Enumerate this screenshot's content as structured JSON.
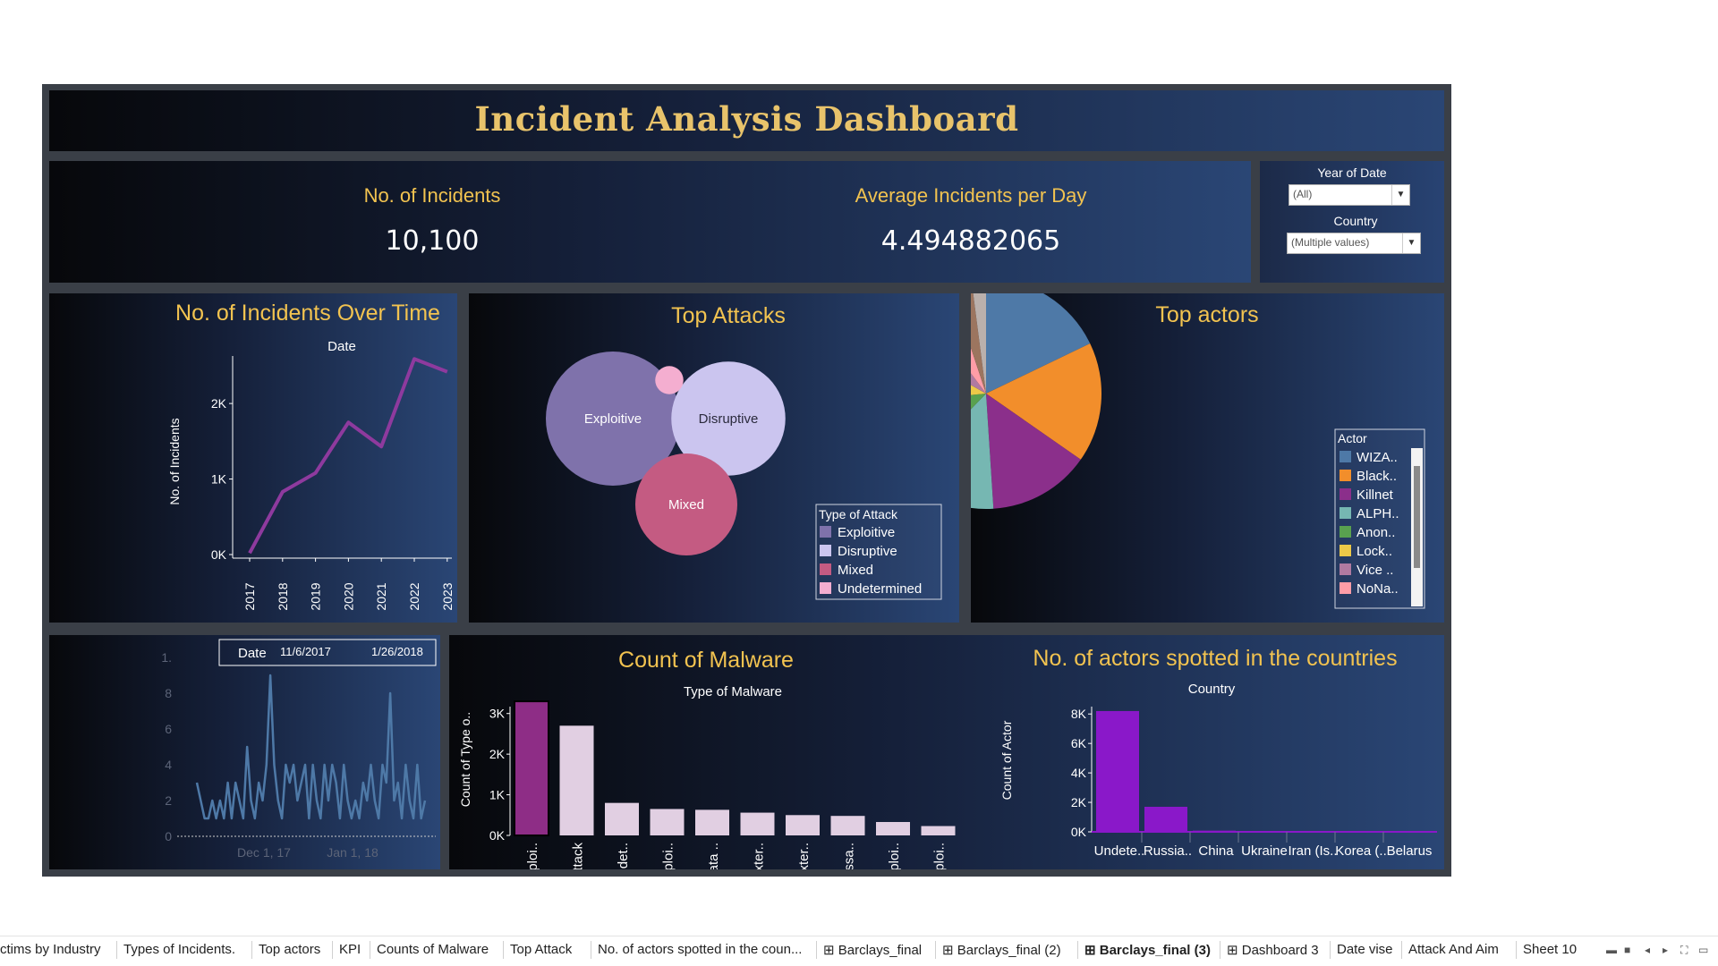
{
  "dashboard": {
    "title": "Incident Analysis Dashboard",
    "kpis": [
      {
        "label": "No. of Incidents",
        "value": "10,100"
      },
      {
        "label": "Average Incidents per Day",
        "value": "4.494882065"
      }
    ],
    "filters": [
      {
        "label": "Year of Date",
        "value": "(All)"
      },
      {
        "label": "Country",
        "value": "(Multiple values)"
      }
    ]
  },
  "tabs": [
    {
      "label": "ctims by Industry",
      "icon": ""
    },
    {
      "label": "Types of Incidents.",
      "icon": ""
    },
    {
      "label": "Top actors",
      "icon": ""
    },
    {
      "label": "KPI",
      "icon": ""
    },
    {
      "label": "Counts of Malware",
      "icon": ""
    },
    {
      "label": "Top Attack",
      "icon": ""
    },
    {
      "label": "No. of actors spotted in the coun...",
      "icon": ""
    },
    {
      "label": "Barclays_final",
      "icon": "⊞"
    },
    {
      "label": "Barclays_final (2)",
      "icon": "⊞"
    },
    {
      "label": "Barclays_final (3)",
      "icon": "⊞",
      "active": true
    },
    {
      "label": "Dashboard 3",
      "icon": "⊞"
    },
    {
      "label": "Date vise",
      "icon": ""
    },
    {
      "label": "Attack And Aim",
      "icon": ""
    },
    {
      "label": "Sheet 10",
      "icon": ""
    }
  ],
  "chart_data": [
    {
      "type": "line",
      "title": "No. of Incidents Over Time",
      "xlabel": "Date",
      "ylabel": "No. of Incidents",
      "x": [
        "2017",
        "2018",
        "2019",
        "2020",
        "2021",
        "2022",
        "2023"
      ],
      "values": [
        20,
        830,
        1080,
        1750,
        1430,
        2590,
        2420
      ],
      "y_ticks": [
        "0K",
        "1K",
        "2K"
      ],
      "ylim": [
        0,
        2700
      ],
      "color": "#8e3a9e"
    },
    {
      "type": "bubble",
      "title": "Top Attacks",
      "legend_title": "Type of Attack",
      "categories": [
        "Exploitive",
        "Disruptive",
        "Mixed",
        "Undetermined"
      ],
      "labels_shown": [
        "Exploitive",
        "Disruptive",
        "Mixed",
        ""
      ],
      "relative_size": [
        1.0,
        0.85,
        0.76,
        0.21
      ],
      "colors": [
        "#7f72ab",
        "#cbc5ef",
        "#c45b82",
        "#f4aed0"
      ]
    },
    {
      "type": "pie",
      "title": "Top actors",
      "legend_title": "Actor",
      "legend_labels": [
        "WIZA..",
        "Black..",
        "Killnet",
        "ALPH..",
        "Anon..",
        "Lock..",
        "Vice ..",
        "NoNa.."
      ],
      "colors": [
        "#4e79a7",
        "#f28e2b",
        "#8b2f8b",
        "#76b7b2",
        "#59a14f",
        "#edc948",
        "#b07aa1",
        "#ff9da7",
        "#9c755f",
        "#bab0ac"
      ],
      "values": [
        17.5,
        16.5,
        14.0,
        13.0,
        11.0,
        9.5,
        6.5,
        5.0,
        3.0,
        2.0
      ]
    },
    {
      "type": "line",
      "title": "",
      "range_label": "Date",
      "range_start": "11/6/2017",
      "range_end": "1/26/2018",
      "x_ticks": [
        "Dec 1, 17",
        "Jan 1, 18"
      ],
      "y_ticks": [
        "0",
        "2",
        "4",
        "6",
        "8",
        "1."
      ],
      "values": [
        3,
        2,
        1,
        1,
        2,
        1,
        2,
        1,
        3,
        1,
        3,
        2,
        1,
        5,
        2,
        1,
        3,
        2,
        4,
        9,
        4,
        2,
        1,
        4,
        3,
        4,
        2,
        3,
        4,
        1,
        4,
        2,
        1,
        4,
        2,
        4,
        3,
        1,
        4,
        2,
        1,
        2,
        1,
        3,
        2,
        4,
        2,
        1,
        4,
        3,
        8,
        2,
        3,
        1,
        4,
        2,
        1,
        4,
        1,
        2
      ],
      "ylim": [
        0,
        10
      ],
      "color": "#4e79a7"
    },
    {
      "type": "bar",
      "title": "Count of Malware",
      "xlabel": "Type of Malware",
      "ylabel": "Count of Type o..",
      "categories": [
        "Exploi..",
        "Data Attack",
        "Undet..",
        "Exploi..",
        "Data ..",
        "Exter..",
        "Exter..",
        "Messa..",
        "Exploi..",
        "Exploi.."
      ],
      "values": [
        3300,
        2700,
        800,
        650,
        630,
        560,
        500,
        480,
        330,
        230
      ],
      "y_ticks": [
        "0K",
        "1K",
        "2K",
        "3K"
      ],
      "ylim": [
        0,
        3500
      ],
      "colors": [
        "#8e2d86",
        "#e1cfe2"
      ]
    },
    {
      "type": "bar",
      "title": "No. of actors spotted in the countries",
      "xlabel": "Country",
      "ylabel": "Count of Actor",
      "categories": [
        "Undete..",
        "Russia..",
        "China",
        "Ukraine",
        "Iran (Is..",
        "Korea (..",
        "Belarus"
      ],
      "values": [
        8200,
        1700,
        80,
        60,
        20,
        15,
        10
      ],
      "y_ticks": [
        "0K",
        "2K",
        "4K",
        "6K",
        "8K"
      ],
      "ylim": [
        0,
        8500
      ],
      "color": "#8a18c9"
    }
  ]
}
